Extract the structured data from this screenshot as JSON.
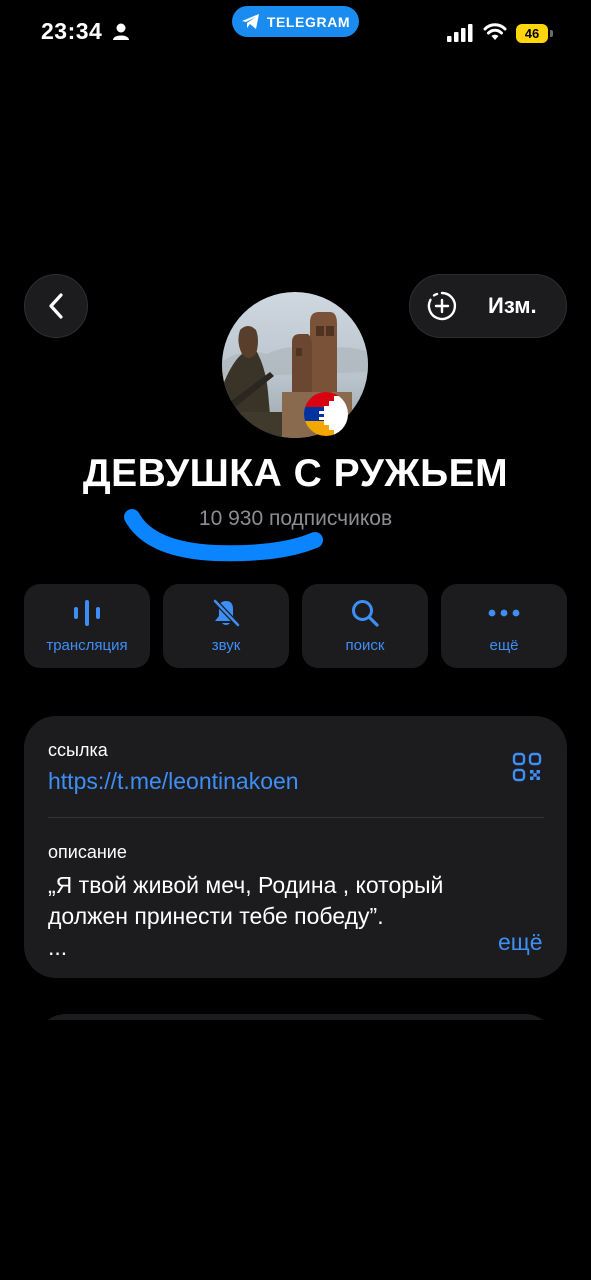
{
  "status_bar": {
    "time": "23:34",
    "app_pill": "TELEGRAM",
    "battery": "46"
  },
  "nav": {
    "edit_label": "Изм."
  },
  "channel": {
    "title": "ДЕВУШКА С РУЖЬЕМ",
    "subscribers": "10 930 подписчиков"
  },
  "actions": [
    {
      "label": "трансляция",
      "icon": "broadcast-icon"
    },
    {
      "label": "звук",
      "icon": "bell-muted-icon"
    },
    {
      "label": "поиск",
      "icon": "search-icon"
    },
    {
      "label": "ещё",
      "icon": "more-dots-icon"
    }
  ],
  "info": {
    "link_caption": "ссылка",
    "link_value": "https://t.me/leontinakoen",
    "description_caption": "описание",
    "description_line1": "„Я твой живой меч, Родина , который",
    "description_line2": "должен принести тебе победу”.",
    "description_ellipsis": "...",
    "more_label": "ещё"
  },
  "colors": {
    "accent": "#3e8ef7",
    "telegram_pill": "#1a8cf0",
    "card_bg": "#1c1c1e",
    "scribble": "#0a84ff",
    "battery": "#ffd60a"
  }
}
